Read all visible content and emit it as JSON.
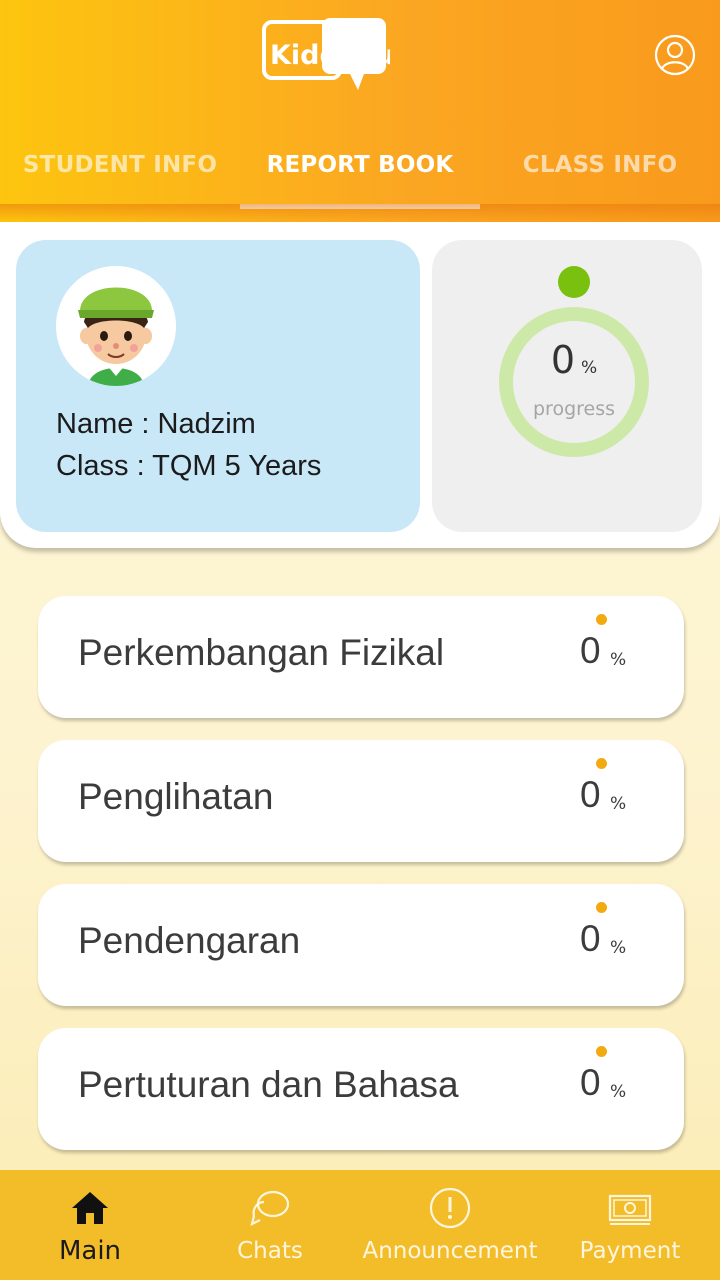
{
  "header": {
    "logo_text": "Kiddy2u",
    "tabs": [
      {
        "label": "STUDENT INFO"
      },
      {
        "label": "REPORT BOOK"
      },
      {
        "label": "CLASS INFO"
      }
    ],
    "active_tab": "REPORT BOOK",
    "profile_icon": "user-circle-icon"
  },
  "student": {
    "name_line": "Name : Nadzim",
    "class_line": "Class : TQM 5 Years",
    "avatar_icon": "boy-avatar-icon"
  },
  "progress": {
    "value": "0",
    "unit": "%",
    "label": "progress",
    "fraction": 0,
    "dot_color": "#7ac10f",
    "ring_color": "#cde9a8"
  },
  "categories": [
    {
      "name": "Perkembangan Fizikal",
      "value": "0",
      "unit": "%"
    },
    {
      "name": "Penglihatan",
      "value": "0",
      "unit": "%"
    },
    {
      "name": "Pendengaran",
      "value": "0",
      "unit": "%"
    },
    {
      "name": "Pertuturan dan Bahasa",
      "value": "0",
      "unit": "%"
    }
  ],
  "bottom_nav": [
    {
      "label": "Main",
      "icon": "home-icon",
      "active": true
    },
    {
      "label": "Chats",
      "icon": "chat-bubbles-icon",
      "active": false
    },
    {
      "label": "Announcement",
      "icon": "exclamation-circle-icon",
      "active": false
    },
    {
      "label": "Payment",
      "icon": "banknote-icon",
      "active": false
    }
  ],
  "colors": {
    "header_start": "#fdc50f",
    "header_end": "#f99a1c",
    "student_panel": "#c8e7f7",
    "category_dot": "#f3aa10",
    "nav_bg": "#f3bd2a"
  }
}
